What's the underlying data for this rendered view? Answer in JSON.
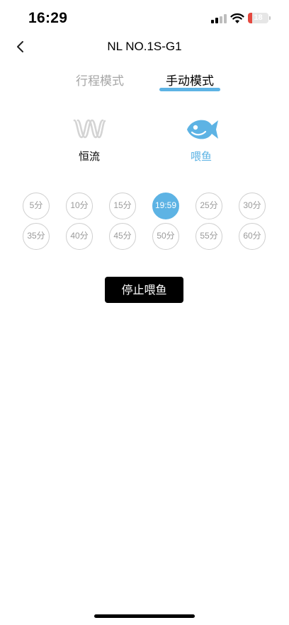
{
  "status_bar": {
    "time": "16:29",
    "battery_level": "18",
    "icons": [
      "cellular-signal-icon",
      "wifi-icon",
      "battery-icon"
    ]
  },
  "nav": {
    "back_icon": "chevron-left-icon",
    "title": "NL NO.1S-G1"
  },
  "tabs": [
    {
      "label": "行程模式",
      "active": false
    },
    {
      "label": "手动模式",
      "active": true
    }
  ],
  "modes": [
    {
      "label": "恒流",
      "icon": "wave-flow-icon",
      "selected": false
    },
    {
      "label": "喂鱼",
      "icon": "fish-icon",
      "selected": true
    }
  ],
  "time_options": [
    {
      "label": "5分",
      "active": false
    },
    {
      "label": "10分",
      "active": false
    },
    {
      "label": "15分",
      "active": false
    },
    {
      "label": "19:59",
      "active": true
    },
    {
      "label": "25分",
      "active": false
    },
    {
      "label": "30分",
      "active": false
    },
    {
      "label": "35分",
      "active": false
    },
    {
      "label": "40分",
      "active": false
    },
    {
      "label": "45分",
      "active": false
    },
    {
      "label": "50分",
      "active": false
    },
    {
      "label": "55分",
      "active": false
    },
    {
      "label": "60分",
      "active": false
    }
  ],
  "stop_button": {
    "label": "停止喂鱼"
  },
  "colors": {
    "accent": "#5db3e4",
    "inactive_text": "#a6a6a6",
    "button_bg": "#000000"
  }
}
